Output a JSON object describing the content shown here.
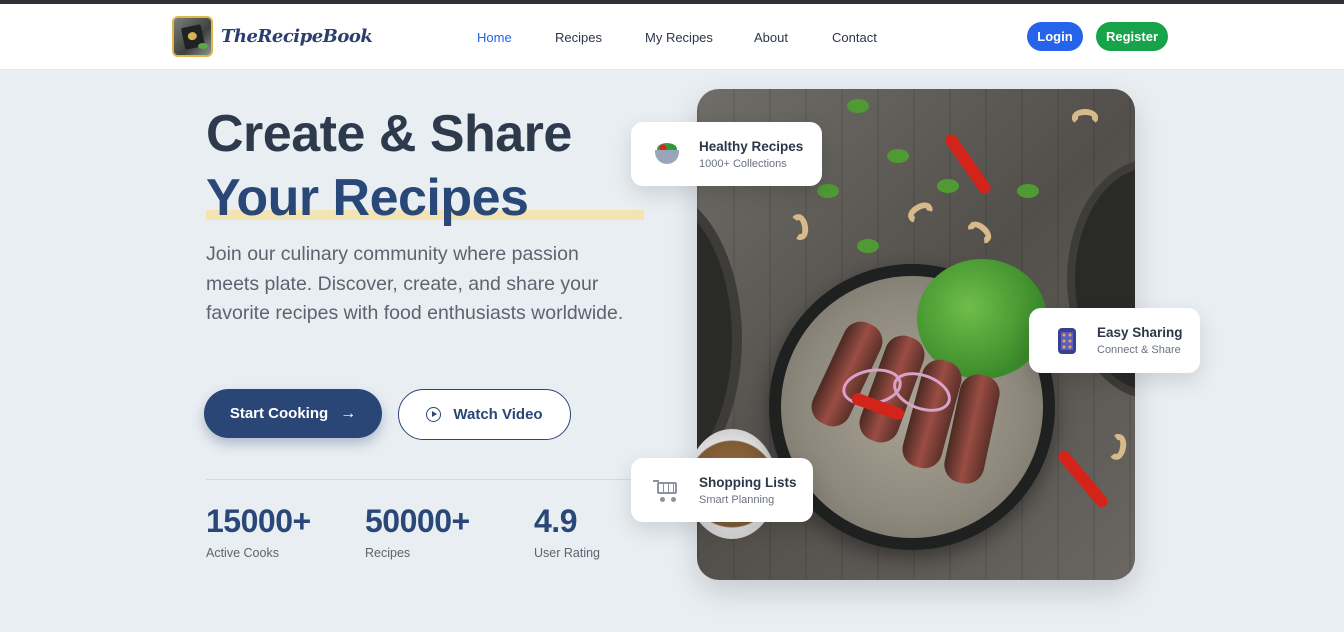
{
  "brand": {
    "name": "TheRecipeBook"
  },
  "nav": {
    "links": [
      {
        "label": "Home",
        "active": true
      },
      {
        "label": "Recipes",
        "active": false
      },
      {
        "label": "My Recipes",
        "active": false
      },
      {
        "label": "About",
        "active": false
      },
      {
        "label": "Contact",
        "active": false
      }
    ],
    "login_label": "Login",
    "register_label": "Register"
  },
  "hero": {
    "title_line1": "Create & Share",
    "title_line2": "Your Recipes",
    "description": "Join our culinary community where passion meets plate. Discover, create, and share your favorite recipes with food enthusiasts worldwide.",
    "start_button": "Start Cooking",
    "start_button_icon": "arrow-right-icon",
    "watch_button": "Watch Video",
    "watch_button_icon": "play-circle-icon"
  },
  "stats": [
    {
      "value": "15000+",
      "label": "Active Cooks"
    },
    {
      "value": "50000+",
      "label": "Recipes"
    },
    {
      "value": "4.9",
      "label": "User Rating"
    }
  ],
  "feature_cards": [
    {
      "title": "Healthy Recipes",
      "subtitle": "1000+ Collections",
      "icon": "salad-icon"
    },
    {
      "title": "Easy Sharing",
      "subtitle": "Connect & Share",
      "icon": "mobile-phone-icon"
    },
    {
      "title": "Shopping Lists",
      "subtitle": "Smart Planning",
      "icon": "shopping-cart-icon"
    }
  ],
  "colors": {
    "primary": "#2a4676",
    "link_active": "#2563eb",
    "login": "#2563eb",
    "register": "#16a34a",
    "background": "#e9eef3",
    "highlight": "#f3e4b3"
  }
}
